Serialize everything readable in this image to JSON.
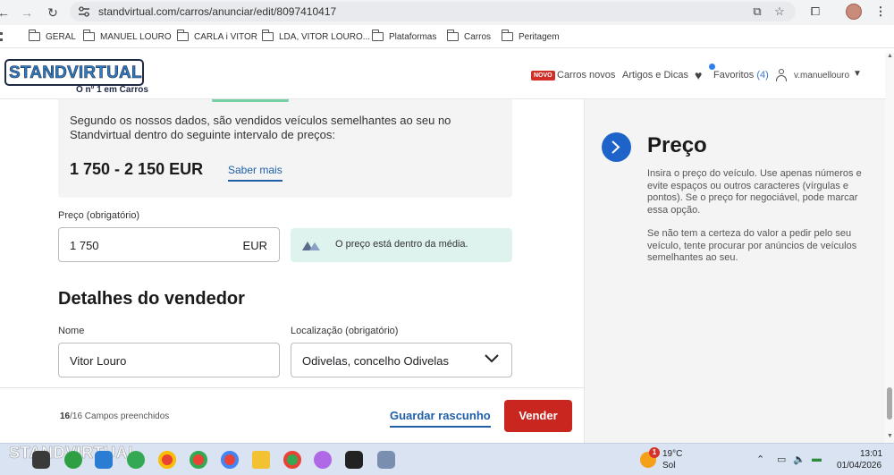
{
  "browser": {
    "url": "standvirtual.com/carros/anunciar/edit/8097410417",
    "bookmarks": [
      "GERAL",
      "MANUEL LOURO",
      "CARLA i VITOR",
      "LDA, VITOR LOURO...",
      "Plataformas",
      "Carros",
      "Peritagem"
    ]
  },
  "header": {
    "logo": "STANDVIRTUAL",
    "tagline": "O nº 1 em Carros",
    "novo_badge": "NOVO",
    "nav": {
      "carros_novos": "Carros novos",
      "artigos": "Artigos e Dicas",
      "favoritos": "Favoritos",
      "favoritos_count": "(4)",
      "user": "v.manuellouro"
    }
  },
  "price_info": {
    "paragraph": "Segundo os nossos dados, são vendidos veículos semelhantes ao seu no Standvirtual dentro do seguinte intervalo de preços:",
    "range": "1 750 - 2 150 EUR",
    "learn_more": "Saber mais"
  },
  "price_field": {
    "label": "Preço (obrigatório)",
    "value": "1 750",
    "unit": "EUR",
    "feedback": "O preço está dentro da média."
  },
  "seller": {
    "title": "Detalhes do vendedor",
    "name_label": "Nome",
    "name_value": "Vitor Louro",
    "location_label": "Localização (obrigatório)",
    "location_value": "Odivelas, concelho Odivelas"
  },
  "sidebar": {
    "title": "Preço",
    "para1": "Insira o preço do veículo. Use apenas números e evite espaços ou outros caracteres (vírgulas e pontos). Se o preço for negociável, pode marcar essa opção.",
    "para2": "Se não tem a certeza do valor a pedir pelo seu veículo, tente procurar por anúncios de veículos semelhantes ao seu."
  },
  "action_bar": {
    "fields_done": "16",
    "fields_total": "/16 Campos preenchidos",
    "draft": "Guardar rascunho",
    "sell": "Vender"
  },
  "taskbar": {
    "watermark": "STANDVIRTUAL",
    "weather_badge": "1",
    "temperature": "19°C",
    "condition": "Sol",
    "time": "13:01",
    "date": "01/04/2026"
  },
  "colors": {
    "accent_blue": "#1e63c9",
    "sell_red": "#c8261f",
    "feedback_bg": "#dff3ee",
    "novo_red": "#d32d27"
  }
}
